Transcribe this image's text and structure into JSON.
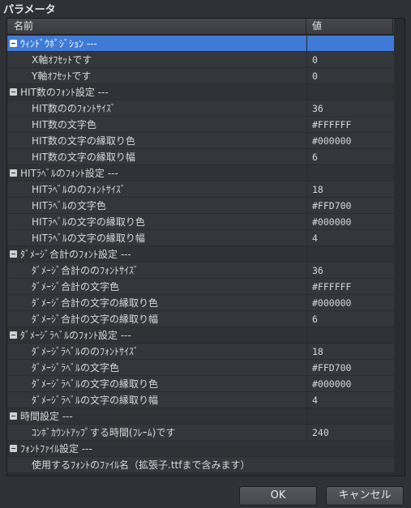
{
  "window": {
    "title": "パラメータ"
  },
  "header": {
    "name": "名前",
    "value": "値"
  },
  "rows": [
    {
      "type": "group",
      "label": "ｳｨﾝﾄﾞｳﾎﾟｼﾞｼｮﾝ ---",
      "value": "",
      "selected": true
    },
    {
      "type": "item",
      "label": "X軸ｵﾌｾｯﾄです",
      "value": "0"
    },
    {
      "type": "item",
      "label": "Y軸ｵﾌｾｯﾄです",
      "value": "0"
    },
    {
      "type": "group",
      "label": "HIT数のﾌｫﾝﾄ設定 ---",
      "value": ""
    },
    {
      "type": "item",
      "label": "HIT数ののﾌｫﾝﾄｻｲｽﾞ",
      "value": "36"
    },
    {
      "type": "item",
      "label": "HIT数の文字色",
      "value": "#FFFFFF"
    },
    {
      "type": "item",
      "label": "HIT数の文字の縁取り色",
      "value": "#000000"
    },
    {
      "type": "item",
      "label": "HIT数の文字の縁取り幅",
      "value": "6"
    },
    {
      "type": "group",
      "label": "HITﾗﾍﾞﾙのﾌｫﾝﾄ設定 ---",
      "value": ""
    },
    {
      "type": "item",
      "label": "HITﾗﾍﾞﾙののﾌｫﾝﾄｻｲｽﾞ",
      "value": "18"
    },
    {
      "type": "item",
      "label": "HITﾗﾍﾞﾙの文字色",
      "value": "#FFD700"
    },
    {
      "type": "item",
      "label": "HITﾗﾍﾞﾙの文字の縁取り色",
      "value": "#000000"
    },
    {
      "type": "item",
      "label": "HITﾗﾍﾞﾙの文字の縁取り幅",
      "value": "4"
    },
    {
      "type": "group",
      "label": "ﾀﾞﾒｰｼﾞ合計のﾌｫﾝﾄ設定 ---",
      "value": ""
    },
    {
      "type": "item",
      "label": "ﾀﾞﾒｰｼﾞ合計ののﾌｫﾝﾄｻｲｽﾞ",
      "value": "36"
    },
    {
      "type": "item",
      "label": "ﾀﾞﾒｰｼﾞ合計の文字色",
      "value": "#FFFFFF"
    },
    {
      "type": "item",
      "label": "ﾀﾞﾒｰｼﾞ合計の文字の縁取り色",
      "value": "#000000"
    },
    {
      "type": "item",
      "label": "ﾀﾞﾒｰｼﾞ合計の文字の縁取り幅",
      "value": "6"
    },
    {
      "type": "group",
      "label": "ﾀﾞﾒｰｼﾞﾗﾍﾞﾙのﾌｫﾝﾄ設定 ---",
      "value": ""
    },
    {
      "type": "item",
      "label": "ﾀﾞﾒｰｼﾞﾗﾍﾞﾙののﾌｫﾝﾄｻｲｽﾞ",
      "value": "18"
    },
    {
      "type": "item",
      "label": "ﾀﾞﾒｰｼﾞﾗﾍﾞﾙの文字色",
      "value": "#FFD700"
    },
    {
      "type": "item",
      "label": "ﾀﾞﾒｰｼﾞﾗﾍﾞﾙの文字の縁取り色",
      "value": "#000000"
    },
    {
      "type": "item",
      "label": "ﾀﾞﾒｰｼﾞﾗﾍﾞﾙの文字の縁取り幅",
      "value": "4"
    },
    {
      "type": "group",
      "label": "時間設定 ---",
      "value": ""
    },
    {
      "type": "item",
      "label": "ｺﾝﾎﾞｶｳﾝﾄｱｯﾌﾟする時間(ﾌﾚｰﾑ)です",
      "value": "240"
    },
    {
      "type": "group",
      "label": "ﾌｫﾝﾄﾌｧｲﾙ設定 ---",
      "value": ""
    },
    {
      "type": "item",
      "label": "使用するﾌｫﾝﾄのﾌｧｲﾙ名（拡張子.ttfまで含みます）",
      "value": ""
    }
  ],
  "buttons": {
    "ok": "OK",
    "cancel": "キャンセル"
  },
  "colors": {
    "selection": "#3f7ad6",
    "background": "#2f3136"
  }
}
